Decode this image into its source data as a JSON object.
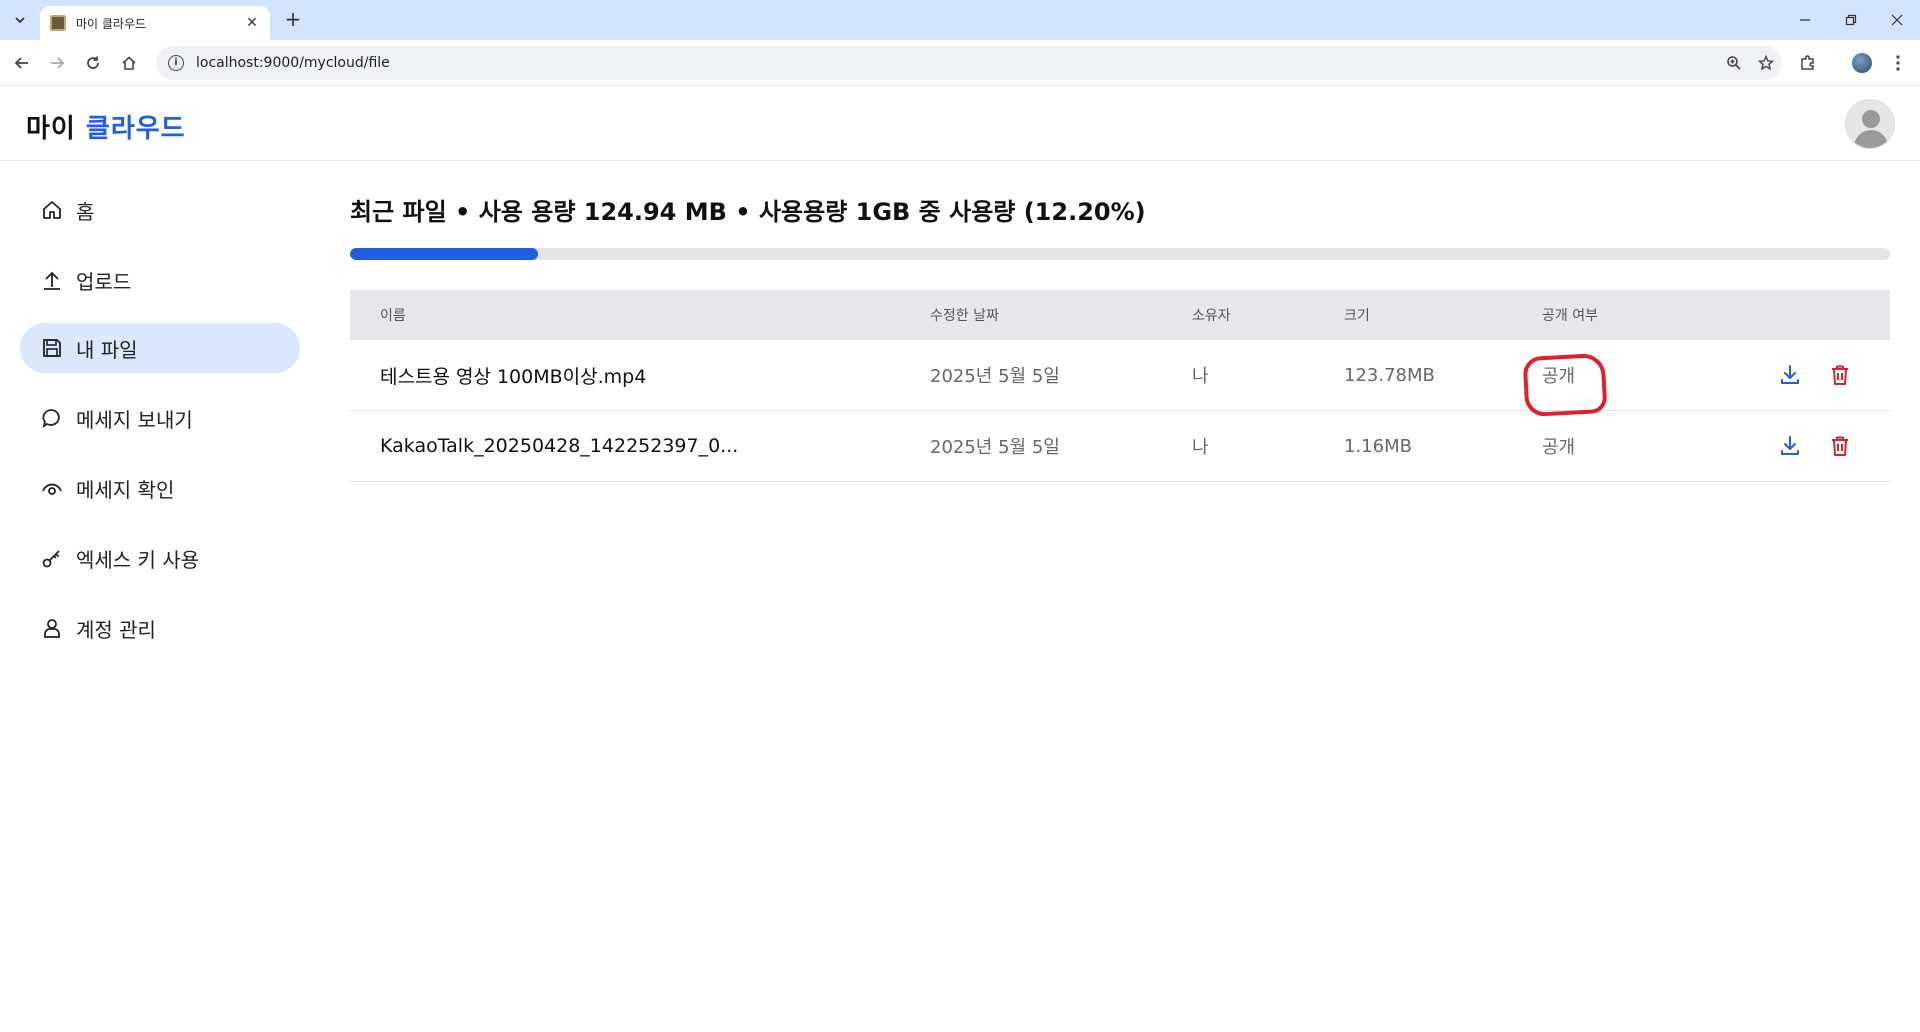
{
  "browser": {
    "tab_title": "마이 클라우드",
    "url": "localhost:9000/mycloud/file",
    "new_tab": "+",
    "tab_close": "✕"
  },
  "app": {
    "brand_part1": "마이",
    "brand_part2": "클라우드",
    "brand_accent_color": "#1f5fe0"
  },
  "sidebar": {
    "items": [
      {
        "label": "홈",
        "icon": "home-icon"
      },
      {
        "label": "업로드",
        "icon": "upload-icon"
      },
      {
        "label": "내 파일",
        "icon": "save-icon",
        "active": true
      },
      {
        "label": "메세지 보내기",
        "icon": "chat-icon"
      },
      {
        "label": "메세지 확인",
        "icon": "eye-icon"
      },
      {
        "label": "엑세스 키 사용",
        "icon": "key-icon"
      },
      {
        "label": "계정 관리",
        "icon": "user-icon"
      }
    ]
  },
  "main": {
    "title": "최근 파일 • 사용 용량 124.94 MB • 사용용량 1GB 중 사용량 (12.20%)",
    "usage_fraction": 0.122,
    "table": {
      "headers": [
        "이름",
        "수정한 날짜",
        "소유자",
        "크기",
        "공개 여부"
      ],
      "rows": [
        {
          "name": "테스트용 영상 100MB이상.mp4",
          "date": "2025년 5월 5일",
          "owner": "나",
          "size": "123.78MB",
          "visibility": "공개"
        },
        {
          "name": "KakaoTalk_20250428_142252397_0...",
          "date": "2025년 5월 5일",
          "owner": "나",
          "size": "1.16MB",
          "visibility": "공개"
        }
      ]
    }
  }
}
